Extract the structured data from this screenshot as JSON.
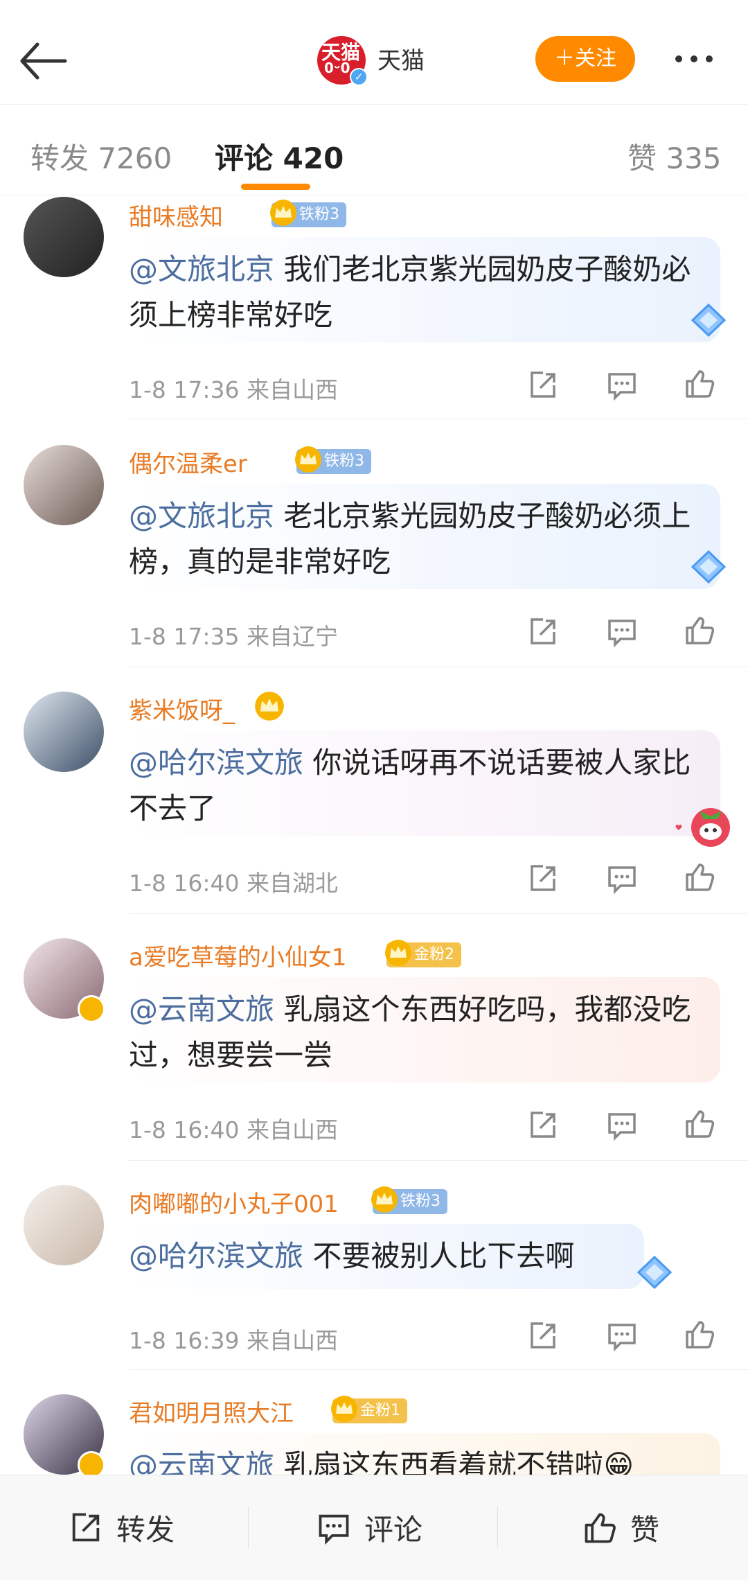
{
  "header": {
    "account_name": "天猫",
    "logo_text": "天猫",
    "logo_sub": "0ᵕ0",
    "follow_label": "＋关注"
  },
  "tabs": [
    {
      "label": "转发 7260"
    },
    {
      "label": "评论 420"
    },
    {
      "label": "赞 335"
    }
  ],
  "comments": [
    {
      "user": "甜味感知",
      "badge": "铁粉3",
      "badge_type": "iron",
      "mention": "@文旅北京",
      "text": " 我们老北京紫光园奶皮子酸奶必须上榜非常好吃",
      "time": "1-8 17:36  来自山西"
    },
    {
      "user": "偶尔温柔er",
      "badge": "铁粉3",
      "badge_type": "iron",
      "mention": "@文旅北京",
      "text": " 老北京紫光园奶皮子酸奶必须上榜，真的是非常好吃",
      "time": "1-8 17:35  来自辽宁"
    },
    {
      "user": "紫米饭呀_",
      "badge": "",
      "badge_type": "crown-only",
      "mention": "@哈尔滨文旅",
      "text": " 你说话呀再不说话要被人家比不去了",
      "time": "1-8 16:40  来自湖北"
    },
    {
      "user": "a爱吃草莓的小仙女1",
      "badge": "金粉2",
      "badge_type": "gold",
      "mention": "@云南文旅",
      "text": " 乳扇这个东西好吃吗，我都没吃过，想要尝一尝",
      "time": "1-8 16:40  来自山西"
    },
    {
      "user": "肉嘟嘟的小丸子001",
      "badge": "铁粉3",
      "badge_type": "iron",
      "mention": "@哈尔滨文旅",
      "text": " 不要被别人比下去啊",
      "time": "1-8 16:39  来自山西"
    },
    {
      "user": "君如明月照大江",
      "badge": "金粉1",
      "badge_type": "gold",
      "mention": "@云南文旅",
      "text": " 乳扇这东西看着就不错啦😁",
      "time": ""
    }
  ],
  "bottom": {
    "repost": "转发",
    "comment": "评论",
    "like": "赞"
  },
  "colors": {
    "accent": "#ff8a00",
    "username": "#e97b24",
    "mention": "#4c6e9e",
    "iron_badge": "#8fb8e8",
    "gold_badge": "#f4c24a"
  }
}
